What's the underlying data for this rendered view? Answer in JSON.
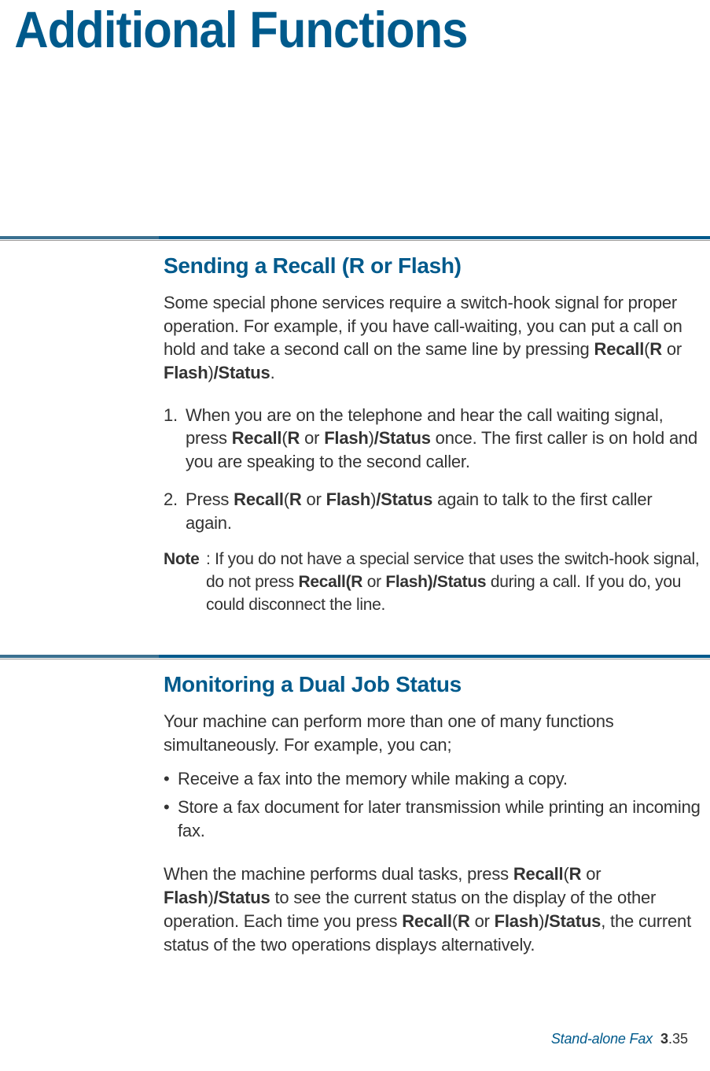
{
  "chapter_title": "Additional Functions",
  "colors": {
    "accent": "#005a8c",
    "text": "#333333"
  },
  "section1": {
    "heading": "Sending a Recall (R or Flash)",
    "intro_a": "Some special phone services require a switch-hook signal for proper operation. For example, if you have call-waiting, you can put a call on hold and take a second call on the same line by pressing ",
    "intro_b": "Recall",
    "intro_c": "(",
    "intro_d": "R",
    "intro_e": " or ",
    "intro_f": "Flash",
    "intro_g": ")",
    "intro_h": "/Status",
    "intro_i": ".",
    "step1_num": "1.",
    "step1_a": "When you are on the telephone and hear the call waiting signal, press ",
    "step1_b": "Recall",
    "step1_c": "(",
    "step1_d": "R",
    "step1_e": " or ",
    "step1_f": "Flash",
    "step1_g": ")",
    "step1_h": "/Status",
    "step1_i": " once. The first caller is on hold and you are speaking to the second caller.",
    "step2_num": "2.",
    "step2_a": "Press ",
    "step2_b": "Recall",
    "step2_c": "(",
    "step2_d": "R",
    "step2_e": " or ",
    "step2_f": "Flash",
    "step2_g": ")",
    "step2_h": "/Status",
    "step2_i": " again to talk to the first caller again.",
    "note_label": "Note",
    "note_a": ": If you do not have a special service that uses the switch-hook signal, do not press ",
    "note_b": "Recall(R",
    "note_c": " or ",
    "note_d": "Flash)/Status",
    "note_e": " during a call. If you do, you could disconnect the line."
  },
  "section2": {
    "heading": "Monitoring a Dual Job Status",
    "intro": "Your machine can perform more than one of many functions simultaneously. For example, you can;",
    "b1_dot": "•",
    "b1": "Receive a fax into the memory while making a copy.",
    "b2_dot": "•",
    "b2": "Store a fax document for later transmission while printing an incoming fax.",
    "p2_a": "When the machine performs dual tasks, press ",
    "p2_b": "Recall",
    "p2_c": "(",
    "p2_d": "R",
    "p2_e": " or ",
    "p2_f": "Flash",
    "p2_g": ")",
    "p2_h": "/Status",
    "p2_i": " to see the current status on the display of the other operation. Each time you press ",
    "p2_j": "Recall",
    "p2_k": "(",
    "p2_l": "R",
    "p2_m": " or ",
    "p2_n": "Flash",
    "p2_o": ")",
    "p2_p": "/Status",
    "p2_q": ", the current status of the two operations displays alternatively."
  },
  "footer": {
    "section_name": "Stand-alone Fax",
    "page_chapter": "3",
    "page_dot": ".",
    "page_num": "35"
  }
}
